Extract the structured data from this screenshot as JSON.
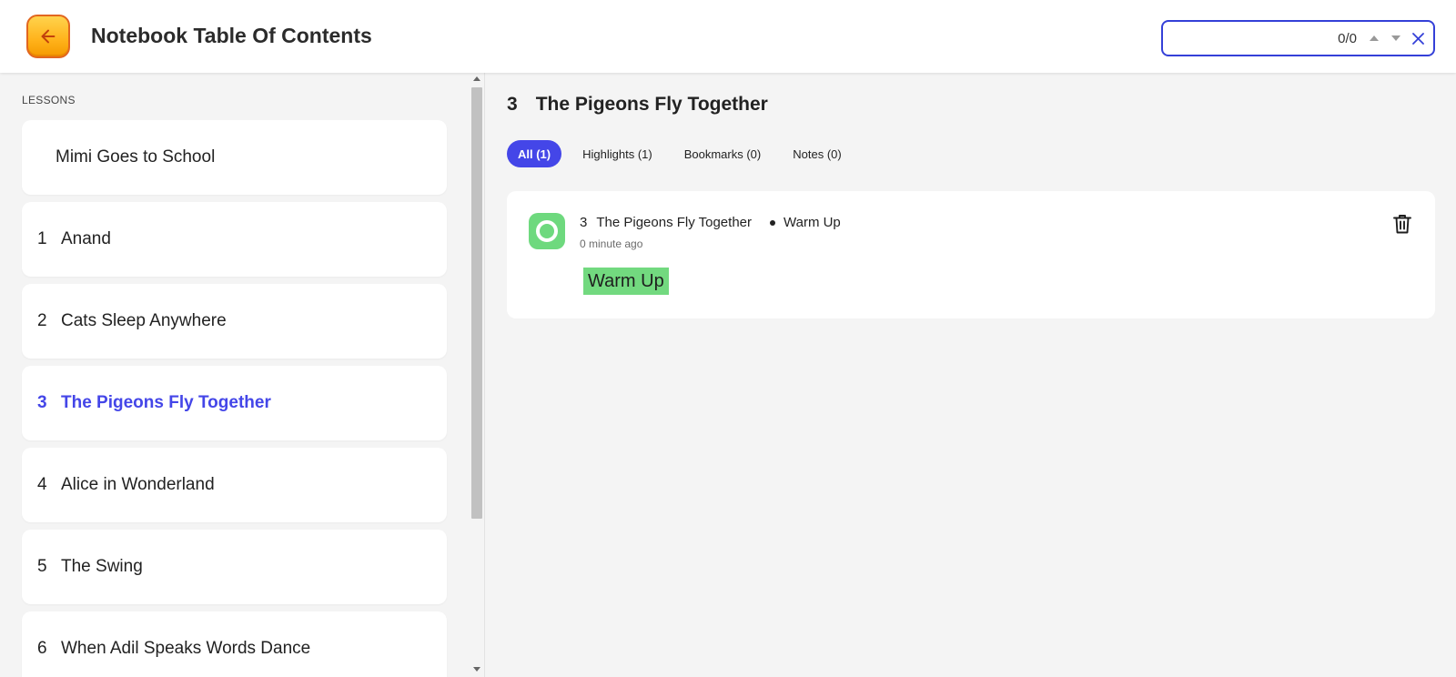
{
  "header": {
    "title": "Notebook Table Of Contents",
    "back_icon": "arrow-left-icon",
    "search": {
      "value": "",
      "placeholder": "",
      "count": "0/0"
    }
  },
  "sidebar": {
    "heading": "LESSONS",
    "items": [
      {
        "num": "",
        "label": "Mimi Goes to School"
      },
      {
        "num": "1",
        "label": "Anand"
      },
      {
        "num": "2",
        "label": "Cats Sleep Anywhere"
      },
      {
        "num": "3",
        "label": "The Pigeons Fly Together"
      },
      {
        "num": "4",
        "label": "Alice in Wonderland"
      },
      {
        "num": "5",
        "label": "The Swing"
      },
      {
        "num": "6",
        "label": "When Adil Speaks Words Dance"
      }
    ],
    "active_index": 3
  },
  "main": {
    "section_num": "3",
    "section_title": "The Pigeons Fly Together",
    "tabs": [
      {
        "label": "All (1)"
      },
      {
        "label": "Highlights (1)"
      },
      {
        "label": "Bookmarks (0)"
      },
      {
        "label": "Notes (0)"
      }
    ],
    "entry": {
      "lesson_num": "3",
      "lesson_title": "The Pigeons Fly Together",
      "section": "Warm Up",
      "time": "0 minute ago",
      "highlight": "Warm Up"
    }
  },
  "colors": {
    "accent": "#4446e8",
    "highlight": "#72d97f",
    "back_button": "#ffb21a",
    "search_border": "#3440d8"
  }
}
